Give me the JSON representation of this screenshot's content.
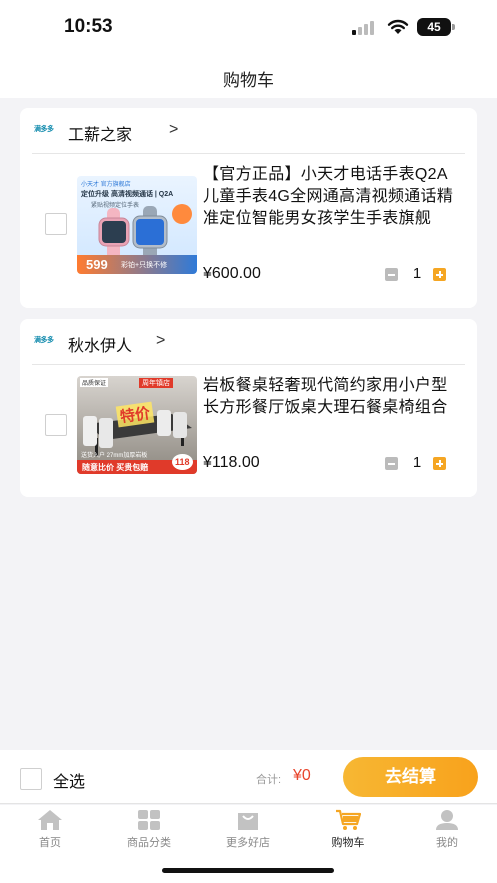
{
  "status_bar": {
    "time": "10:53",
    "battery": "45"
  },
  "header": {
    "title": "购物车"
  },
  "shops": [
    {
      "logo_text": "满多多",
      "name": "工薪之家",
      "chevron": ">",
      "items": [
        {
          "title": "【官方正品】小天才电话手表Q2A儿童手表4G全网通高清视频通话精准定位智能男女孩学生手表旗舰",
          "price": "¥600.00",
          "quantity": "1",
          "image": {
            "badge_top": "小天才 官方旗舰店",
            "banner": "定位升级 高清视频通话 | Q2A",
            "sub_banner": "紧贴视频定位手表",
            "price": "599",
            "promo": "彩铂+只换不修"
          }
        }
      ]
    },
    {
      "logo_text": "满多多",
      "name": "秋水伊人",
      "chevron": ">",
      "items": [
        {
          "title": "岩板餐桌轻奢现代简约家用小户型长方形餐厅饭桌大理石餐桌椅组合",
          "price": "¥118.00",
          "quantity": "1",
          "image": {
            "tag_left": "品质保证",
            "tag_right": "周年镇店",
            "stamp": "特价",
            "caption": "送货入户 27mm加厚岩板",
            "promo": "随意比价 买贵包赔",
            "price": "118"
          }
        }
      ]
    }
  ],
  "checkout": {
    "select_all_label": "全选",
    "total_label": "合计:",
    "total_value": "¥0",
    "button_label": "去结算"
  },
  "tabs": [
    {
      "label": "首页",
      "icon": "home-icon"
    },
    {
      "label": "商品分类",
      "icon": "category-icon"
    },
    {
      "label": "更多好店",
      "icon": "shop-bag-icon"
    },
    {
      "label": "购物车",
      "icon": "cart-icon",
      "active": true
    },
    {
      "label": "我的",
      "icon": "profile-icon"
    }
  ],
  "colors": {
    "accent": "#f5a623",
    "price_red": "#e8452c",
    "background": "#f3f3f6"
  }
}
